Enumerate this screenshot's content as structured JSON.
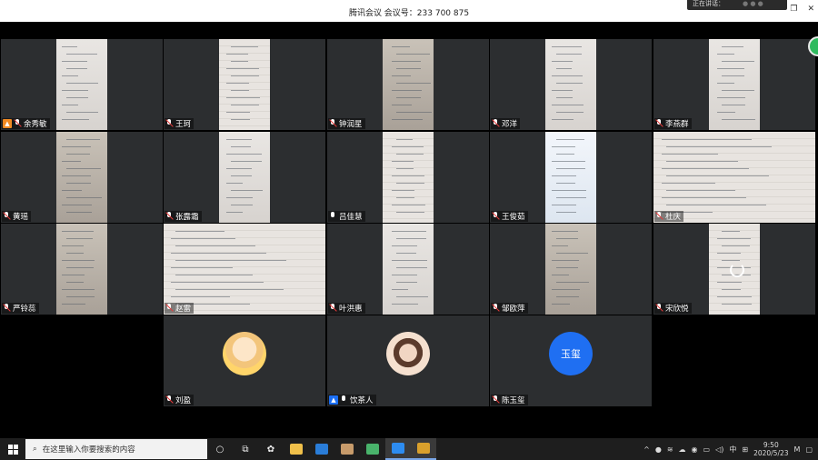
{
  "window": {
    "title": "腾讯会议 会议号：233 700 875",
    "speaking_label": "正在讲话：",
    "min_icon": "minimize-icon",
    "max_icon": "maximize-icon",
    "close_icon": "close-icon"
  },
  "participants": [
    {
      "name": "余秀敏",
      "mic": "muted",
      "badge": "host"
    },
    {
      "name": "王珂",
      "mic": "muted"
    },
    {
      "name": "钟润星",
      "mic": "muted"
    },
    {
      "name": "邓洋",
      "mic": "muted"
    },
    {
      "name": "李燕群",
      "mic": "muted"
    },
    {
      "name": "黄瑶",
      "mic": "muted"
    },
    {
      "name": "张露霜",
      "mic": "muted"
    },
    {
      "name": "吕佳慧",
      "mic": "on"
    },
    {
      "name": "王俊茹",
      "mic": "muted"
    },
    {
      "name": "杜庆",
      "mic": "muted"
    },
    {
      "name": "严铃蕊",
      "mic": "muted"
    },
    {
      "name": "赵雷",
      "mic": "muted"
    },
    {
      "name": "叶洪惠",
      "mic": "muted"
    },
    {
      "name": "邹欧萍",
      "mic": "muted"
    },
    {
      "name": "宋欣悦",
      "mic": "muted"
    },
    {
      "name": "刘盈",
      "mic": "muted"
    },
    {
      "name": "饮茶人",
      "mic": "on",
      "badge": "cohost"
    },
    {
      "name": "陈玉玺",
      "mic": "muted"
    }
  ],
  "avatar_text": "玉玺",
  "taskbar": {
    "search_placeholder": "在这里输入你要搜索的内容",
    "ime": "中",
    "time": "9:50",
    "date": "2020/5/23"
  },
  "colors": {
    "accent_blue": "#1f6ff2",
    "host_orange": "#f28a22",
    "muted_red": "#e43b3b"
  }
}
